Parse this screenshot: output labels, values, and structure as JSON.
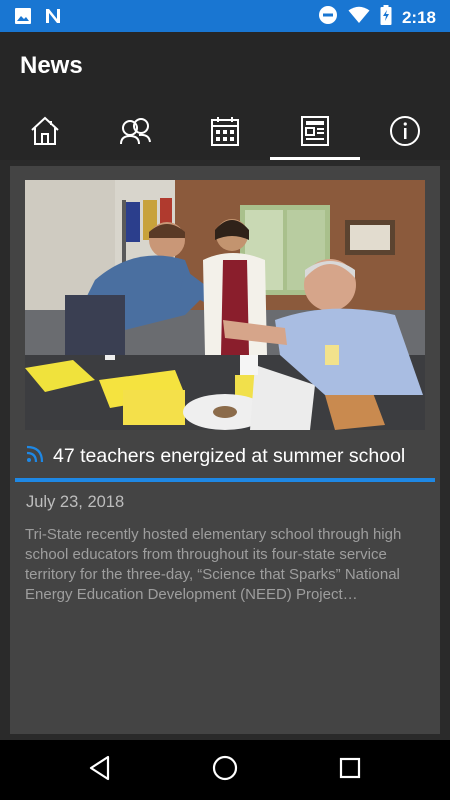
{
  "status_bar": {
    "time": "2:18",
    "icons": [
      "gallery-icon",
      "app-n-icon",
      "do-not-disturb-icon",
      "wifi-icon",
      "battery-charging-icon"
    ]
  },
  "app_bar": {
    "title": "News"
  },
  "tabs": [
    {
      "name": "home",
      "icon": "home-icon",
      "selected": false
    },
    {
      "name": "people",
      "icon": "people-icon",
      "selected": false
    },
    {
      "name": "calendar",
      "icon": "calendar-icon",
      "selected": false
    },
    {
      "name": "news",
      "icon": "newspaper-icon",
      "selected": true
    },
    {
      "name": "info",
      "icon": "info-icon",
      "selected": false
    }
  ],
  "article": {
    "headline": "47 teachers energized at summer school",
    "date": "July 23, 2018",
    "summary": "Tri-State recently hosted elementary school through high school educators from throughout its four-state service territory for the three-day, “Science that Sparks” National Energy Education Development (NEED) Project…",
    "feed_icon": "rss-icon"
  },
  "nav_bar": {
    "buttons": [
      "back-icon",
      "home-circle-icon",
      "recents-icon"
    ]
  },
  "colors": {
    "accent": "#1976d2",
    "rule": "#1e88e5",
    "card": "#444444"
  }
}
